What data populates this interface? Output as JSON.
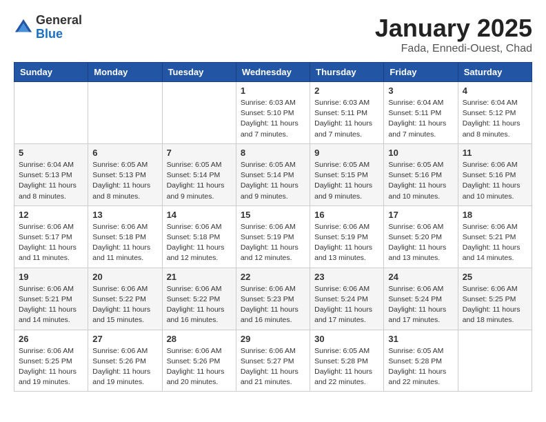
{
  "header": {
    "logo_general": "General",
    "logo_blue": "Blue",
    "title": "January 2025",
    "subtitle": "Fada, Ennedi-Ouest, Chad"
  },
  "weekdays": [
    "Sunday",
    "Monday",
    "Tuesday",
    "Wednesday",
    "Thursday",
    "Friday",
    "Saturday"
  ],
  "weeks": [
    [
      {
        "day": "",
        "sunrise": "",
        "sunset": "",
        "daylight": ""
      },
      {
        "day": "",
        "sunrise": "",
        "sunset": "",
        "daylight": ""
      },
      {
        "day": "",
        "sunrise": "",
        "sunset": "",
        "daylight": ""
      },
      {
        "day": "1",
        "sunrise": "Sunrise: 6:03 AM",
        "sunset": "Sunset: 5:10 PM",
        "daylight": "Daylight: 11 hours and 7 minutes."
      },
      {
        "day": "2",
        "sunrise": "Sunrise: 6:03 AM",
        "sunset": "Sunset: 5:11 PM",
        "daylight": "Daylight: 11 hours and 7 minutes."
      },
      {
        "day": "3",
        "sunrise": "Sunrise: 6:04 AM",
        "sunset": "Sunset: 5:11 PM",
        "daylight": "Daylight: 11 hours and 7 minutes."
      },
      {
        "day": "4",
        "sunrise": "Sunrise: 6:04 AM",
        "sunset": "Sunset: 5:12 PM",
        "daylight": "Daylight: 11 hours and 8 minutes."
      }
    ],
    [
      {
        "day": "5",
        "sunrise": "Sunrise: 6:04 AM",
        "sunset": "Sunset: 5:13 PM",
        "daylight": "Daylight: 11 hours and 8 minutes."
      },
      {
        "day": "6",
        "sunrise": "Sunrise: 6:05 AM",
        "sunset": "Sunset: 5:13 PM",
        "daylight": "Daylight: 11 hours and 8 minutes."
      },
      {
        "day": "7",
        "sunrise": "Sunrise: 6:05 AM",
        "sunset": "Sunset: 5:14 PM",
        "daylight": "Daylight: 11 hours and 9 minutes."
      },
      {
        "day": "8",
        "sunrise": "Sunrise: 6:05 AM",
        "sunset": "Sunset: 5:14 PM",
        "daylight": "Daylight: 11 hours and 9 minutes."
      },
      {
        "day": "9",
        "sunrise": "Sunrise: 6:05 AM",
        "sunset": "Sunset: 5:15 PM",
        "daylight": "Daylight: 11 hours and 9 minutes."
      },
      {
        "day": "10",
        "sunrise": "Sunrise: 6:05 AM",
        "sunset": "Sunset: 5:16 PM",
        "daylight": "Daylight: 11 hours and 10 minutes."
      },
      {
        "day": "11",
        "sunrise": "Sunrise: 6:06 AM",
        "sunset": "Sunset: 5:16 PM",
        "daylight": "Daylight: 11 hours and 10 minutes."
      }
    ],
    [
      {
        "day": "12",
        "sunrise": "Sunrise: 6:06 AM",
        "sunset": "Sunset: 5:17 PM",
        "daylight": "Daylight: 11 hours and 11 minutes."
      },
      {
        "day": "13",
        "sunrise": "Sunrise: 6:06 AM",
        "sunset": "Sunset: 5:18 PM",
        "daylight": "Daylight: 11 hours and 11 minutes."
      },
      {
        "day": "14",
        "sunrise": "Sunrise: 6:06 AM",
        "sunset": "Sunset: 5:18 PM",
        "daylight": "Daylight: 11 hours and 12 minutes."
      },
      {
        "day": "15",
        "sunrise": "Sunrise: 6:06 AM",
        "sunset": "Sunset: 5:19 PM",
        "daylight": "Daylight: 11 hours and 12 minutes."
      },
      {
        "day": "16",
        "sunrise": "Sunrise: 6:06 AM",
        "sunset": "Sunset: 5:19 PM",
        "daylight": "Daylight: 11 hours and 13 minutes."
      },
      {
        "day": "17",
        "sunrise": "Sunrise: 6:06 AM",
        "sunset": "Sunset: 5:20 PM",
        "daylight": "Daylight: 11 hours and 13 minutes."
      },
      {
        "day": "18",
        "sunrise": "Sunrise: 6:06 AM",
        "sunset": "Sunset: 5:21 PM",
        "daylight": "Daylight: 11 hours and 14 minutes."
      }
    ],
    [
      {
        "day": "19",
        "sunrise": "Sunrise: 6:06 AM",
        "sunset": "Sunset: 5:21 PM",
        "daylight": "Daylight: 11 hours and 14 minutes."
      },
      {
        "day": "20",
        "sunrise": "Sunrise: 6:06 AM",
        "sunset": "Sunset: 5:22 PM",
        "daylight": "Daylight: 11 hours and 15 minutes."
      },
      {
        "day": "21",
        "sunrise": "Sunrise: 6:06 AM",
        "sunset": "Sunset: 5:22 PM",
        "daylight": "Daylight: 11 hours and 16 minutes."
      },
      {
        "day": "22",
        "sunrise": "Sunrise: 6:06 AM",
        "sunset": "Sunset: 5:23 PM",
        "daylight": "Daylight: 11 hours and 16 minutes."
      },
      {
        "day": "23",
        "sunrise": "Sunrise: 6:06 AM",
        "sunset": "Sunset: 5:24 PM",
        "daylight": "Daylight: 11 hours and 17 minutes."
      },
      {
        "day": "24",
        "sunrise": "Sunrise: 6:06 AM",
        "sunset": "Sunset: 5:24 PM",
        "daylight": "Daylight: 11 hours and 17 minutes."
      },
      {
        "day": "25",
        "sunrise": "Sunrise: 6:06 AM",
        "sunset": "Sunset: 5:25 PM",
        "daylight": "Daylight: 11 hours and 18 minutes."
      }
    ],
    [
      {
        "day": "26",
        "sunrise": "Sunrise: 6:06 AM",
        "sunset": "Sunset: 5:25 PM",
        "daylight": "Daylight: 11 hours and 19 minutes."
      },
      {
        "day": "27",
        "sunrise": "Sunrise: 6:06 AM",
        "sunset": "Sunset: 5:26 PM",
        "daylight": "Daylight: 11 hours and 19 minutes."
      },
      {
        "day": "28",
        "sunrise": "Sunrise: 6:06 AM",
        "sunset": "Sunset: 5:26 PM",
        "daylight": "Daylight: 11 hours and 20 minutes."
      },
      {
        "day": "29",
        "sunrise": "Sunrise: 6:06 AM",
        "sunset": "Sunset: 5:27 PM",
        "daylight": "Daylight: 11 hours and 21 minutes."
      },
      {
        "day": "30",
        "sunrise": "Sunrise: 6:05 AM",
        "sunset": "Sunset: 5:28 PM",
        "daylight": "Daylight: 11 hours and 22 minutes."
      },
      {
        "day": "31",
        "sunrise": "Sunrise: 6:05 AM",
        "sunset": "Sunset: 5:28 PM",
        "daylight": "Daylight: 11 hours and 22 minutes."
      },
      {
        "day": "",
        "sunrise": "",
        "sunset": "",
        "daylight": ""
      }
    ]
  ]
}
